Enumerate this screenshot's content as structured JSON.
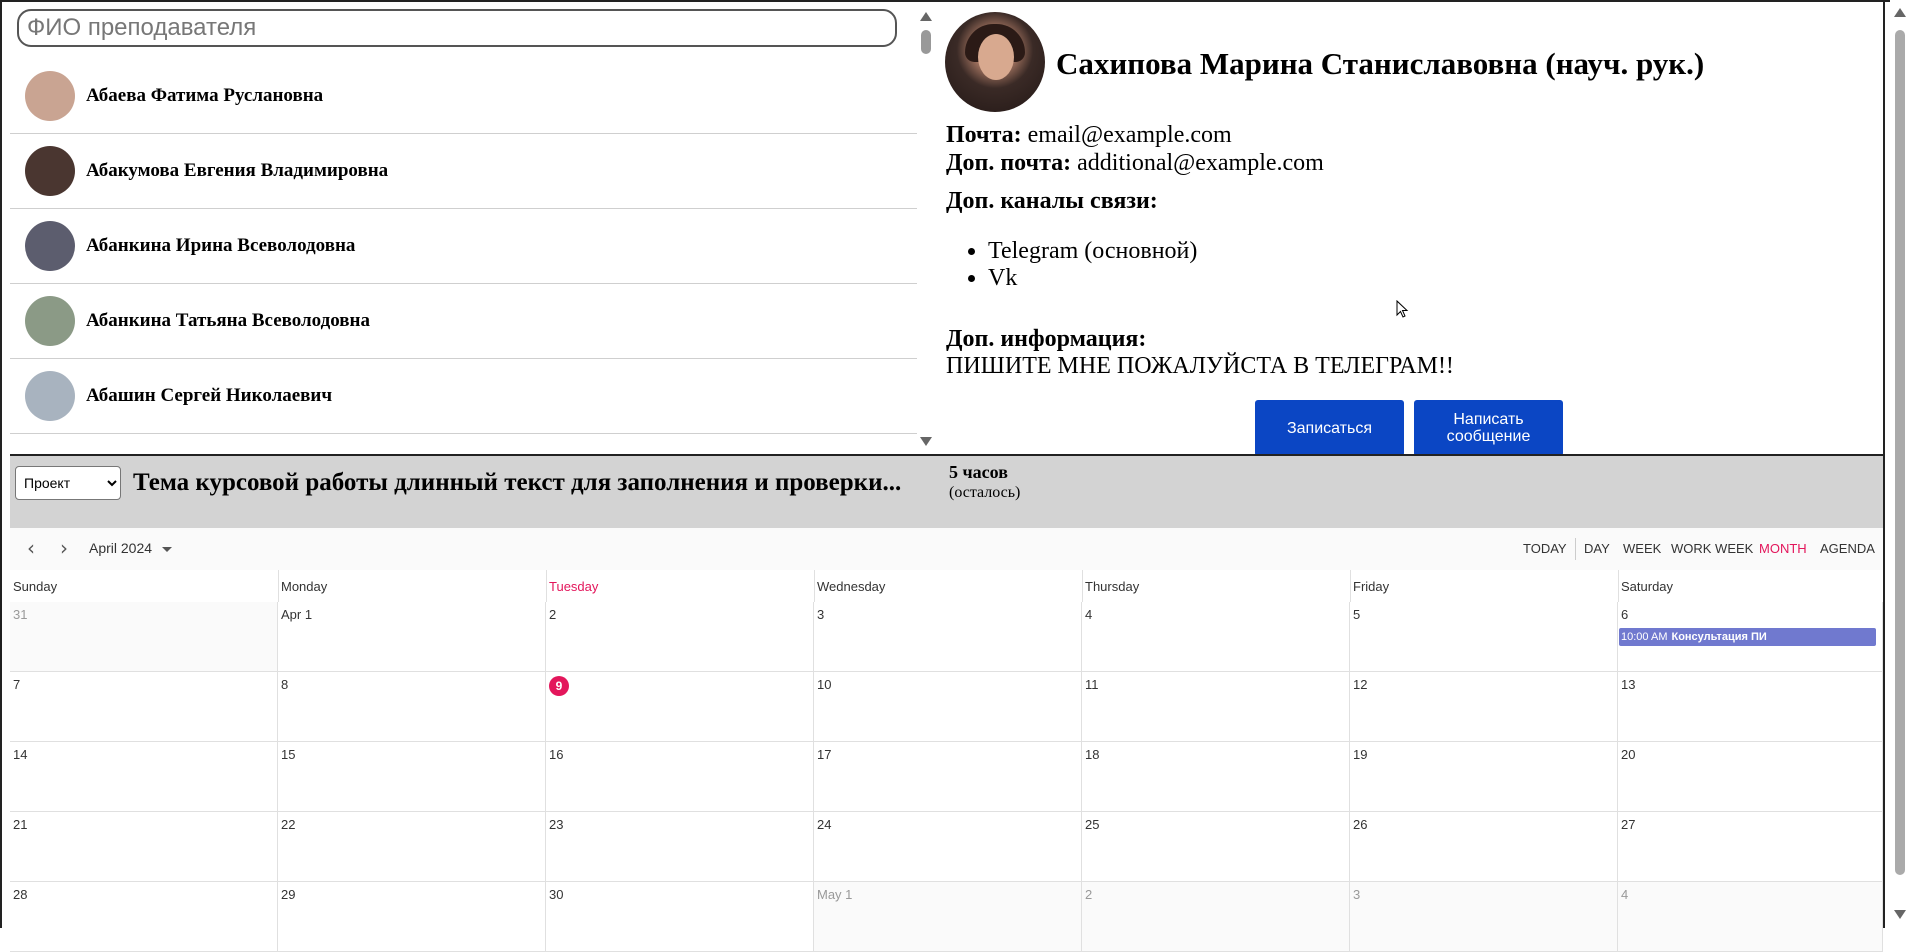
{
  "search": {
    "placeholder": "ФИО преподавателя",
    "value": ""
  },
  "teachers": [
    {
      "name": "Абаева Фатима Руслановна",
      "avatar_color": "#c9a492"
    },
    {
      "name": "Абакумова Евгения Владимировна",
      "avatar_color": "#4a3630"
    },
    {
      "name": "Абанкина Ирина Всеволодовна",
      "avatar_color": "#5c5d6e"
    },
    {
      "name": "Абанкина Татьяна Всеволодовна",
      "avatar_color": "#8b9a86"
    },
    {
      "name": "Абашин Сергей Николаевич",
      "avatar_color": "#a8b3bf"
    }
  ],
  "profile": {
    "name": "Сахипова Марина Станиславовна (науч. рук.)",
    "email_label": "Почта:",
    "email": "email@example.com",
    "extra_email_label": "Доп. почта:",
    "extra_email": "additional@example.com",
    "channels_label": "Доп. каналы связи:",
    "channels": [
      "Telegram (основной)",
      "Vk"
    ],
    "info_label": "Доп. информация:",
    "info": "ПИШИТЕ МНЕ ПОЖАЛУЙСТА В ТЕЛЕГРАМ!!",
    "enroll_button": "Записаться",
    "message_button": "Написать сообщение"
  },
  "project": {
    "select_value": "Проект",
    "options": [
      "Проект"
    ],
    "title": "Тема курсовой работы длинный текст для заполнения и проверки...",
    "hours": "5 часов",
    "hours_note": "(осталось)"
  },
  "calendar": {
    "month_label": "April 2024",
    "views": [
      "TODAY",
      "DAY",
      "WEEK",
      "WORK WEEK",
      "MONTH",
      "AGENDA"
    ],
    "active_view": "MONTH",
    "accent_color": "#e3165b",
    "event_color": "#7079cf",
    "day_names": [
      "Sunday",
      "Monday",
      "Tuesday",
      "Wednesday",
      "Thursday",
      "Friday",
      "Saturday"
    ],
    "today_column": 2,
    "weeks": [
      [
        "31",
        "Apr 1",
        "2",
        "3",
        "4",
        "5",
        "6"
      ],
      [
        "7",
        "8",
        "9",
        "10",
        "11",
        "12",
        "13"
      ],
      [
        "14",
        "15",
        "16",
        "17",
        "18",
        "19",
        "20"
      ],
      [
        "21",
        "22",
        "23",
        "24",
        "25",
        "26",
        "27"
      ],
      [
        "28",
        "29",
        "30",
        "May 1",
        "2",
        "3",
        "4"
      ]
    ],
    "today_date": "9",
    "event": {
      "time": "10:00 AM",
      "title": "Консультация ПИ"
    }
  }
}
